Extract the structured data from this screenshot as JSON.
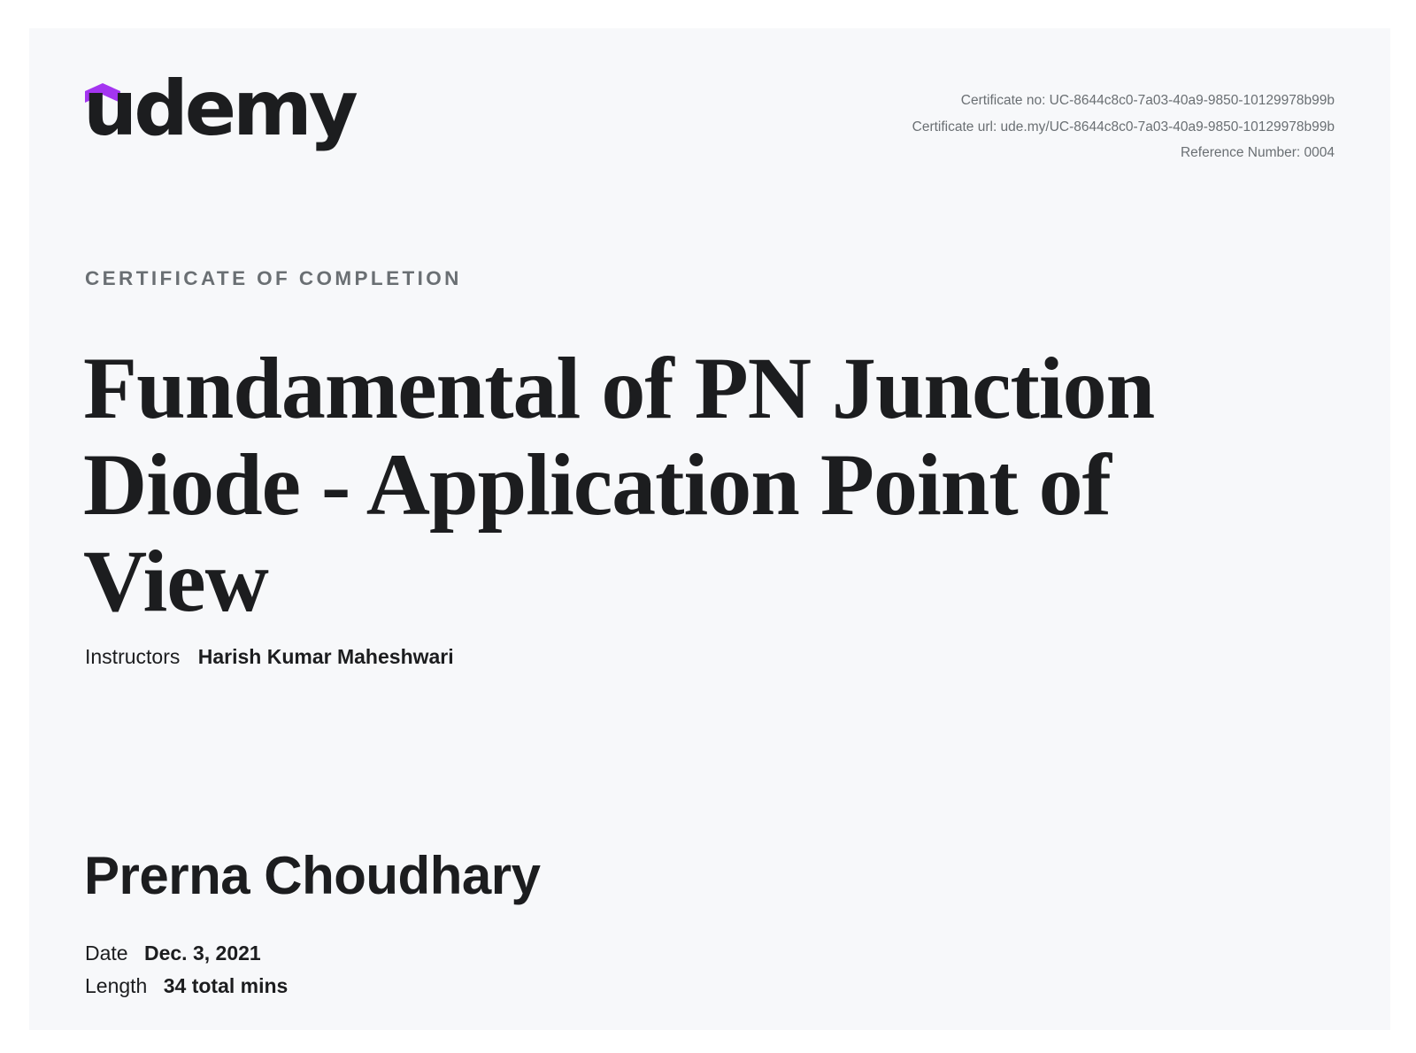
{
  "brand": {
    "logo_text": "udemy",
    "accent_color": "#a435f0",
    "text_color": "#1c1d1f",
    "muted_color": "#6a6f73",
    "background_color": "#f7f8fa"
  },
  "meta": {
    "certificate_no": "Certificate no: UC-8644c8c0-7a03-40a9-9850-10129978b99b",
    "certificate_url": "Certificate url: ude.my/UC-8644c8c0-7a03-40a9-9850-10129978b99b",
    "reference_number": "Reference Number: 0004"
  },
  "certificate": {
    "eyebrow": "CERTIFICATE OF COMPLETION",
    "course_title": "Fundamental of PN Junction Diode - Application Point of View",
    "instructors_label": "Instructors",
    "instructors_value": "Harish Kumar Maheshwari",
    "student_name": "Prerna Choudhary",
    "date_label": "Date",
    "date_value": "Dec. 3, 2021",
    "length_label": "Length",
    "length_value": "34 total mins"
  }
}
